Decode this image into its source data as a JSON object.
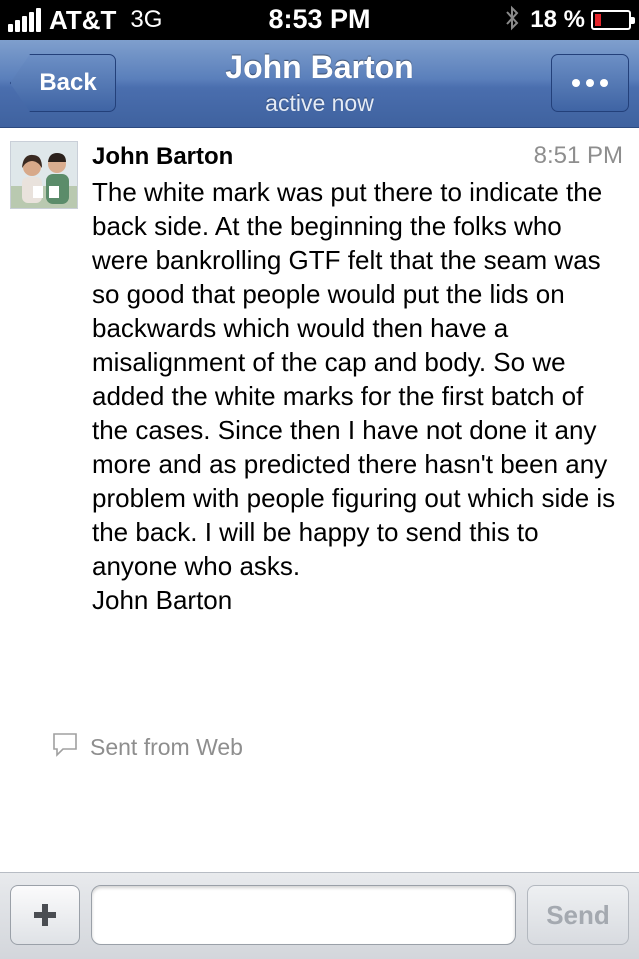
{
  "status_bar": {
    "carrier": "AT&T",
    "network": "3G",
    "time": "8:53 PM",
    "battery_percent": "18 %",
    "battery_level": 0.18,
    "battery_color": "#e4252b"
  },
  "nav": {
    "back_label": "Back",
    "title": "John Barton",
    "subtitle": "active now",
    "more_icon": "more-dots-icon"
  },
  "message": {
    "sender": "John Barton",
    "time": "8:51 PM",
    "body": "The white mark was put there to indicate the back side.  At the beginning the folks who were bankrolling GTF felt that the seam was so good that people would put the lids on backwards which would then have a misalignment of the cap and body. So we added the white marks for the first batch of the cases.  Since then I have not done it any more and as predicted there hasn't been any problem with people figuring out which side is the back.  I will be happy to send this to anyone who asks.",
    "signature": "John Barton",
    "sent_from": "Sent from Web"
  },
  "composer": {
    "input_value": "",
    "send_label": "Send",
    "attach_icon": "plus-icon"
  },
  "colors": {
    "nav_blue": "#4a6eae",
    "timestamp_gray": "#8e8e8e"
  }
}
